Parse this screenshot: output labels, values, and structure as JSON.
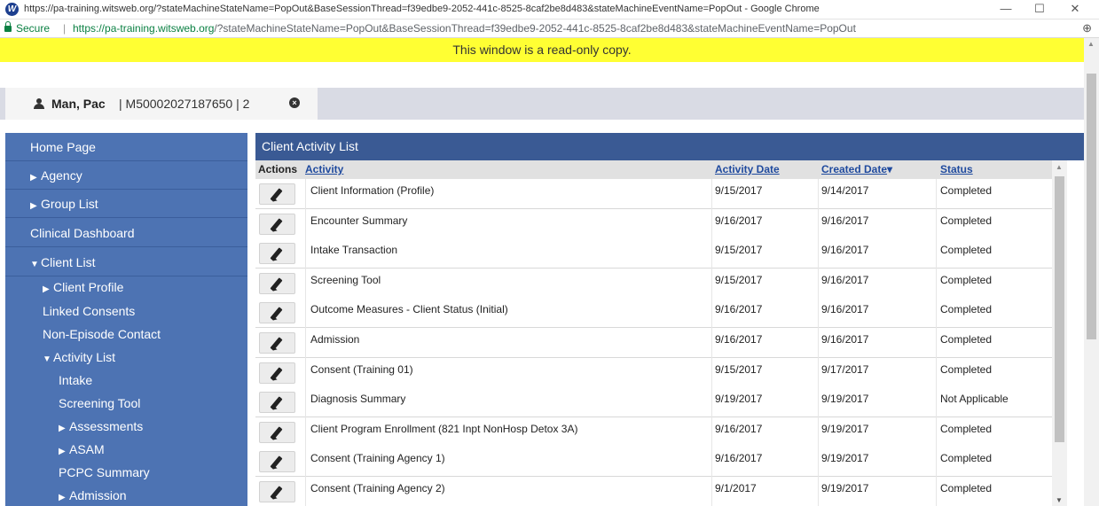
{
  "window": {
    "title": "https://pa-training.witsweb.org/?stateMachineStateName=PopOut&BaseSessionThread=f39edbe9-2052-441c-8525-8caf2be8d483&stateMachineEventName=PopOut - Google Chrome",
    "logo_letter": "W",
    "minimize": "—",
    "maximize": "☐",
    "close": "✕"
  },
  "address_bar": {
    "secure_label": "Secure",
    "separator": "|",
    "url_host": "https://pa-training.witsweb.org",
    "url_rest": "/?stateMachineStateName=PopOut&BaseSessionThread=f39edbe9-2052-441c-8525-8caf2be8d483&stateMachineEventName=PopOut",
    "zoom_icon": "⊕"
  },
  "banner": {
    "text": "This window is a read-only copy."
  },
  "client_tab": {
    "name": "Man, Pac",
    "id_text": "| M50002027187650 | 2",
    "close_glyph": "×"
  },
  "sidebar": {
    "home": "Home Page",
    "agency": "Agency",
    "group_list": "Group List",
    "clinical_dashboard": "Clinical Dashboard",
    "client_list": "Client List",
    "client_profile": "Client Profile",
    "linked_consents": "Linked Consents",
    "non_episode_contact": "Non-Episode Contact",
    "activity_list": "Activity List",
    "intake": "Intake",
    "screening_tool": "Screening Tool",
    "assessments": "Assessments",
    "asam": "ASAM",
    "pcpc_summary": "PCPC Summary",
    "admission": "Admission",
    "arrow_right": "▶",
    "arrow_down": "▼"
  },
  "main": {
    "title": "Client Activity List",
    "columns": {
      "actions": "Actions",
      "activity": "Activity",
      "activity_date": "Activity Date",
      "created_date": "Created Date",
      "sort_glyph": "▾",
      "status": "Status"
    },
    "rows": [
      {
        "activity": "Client Information (Profile)",
        "activity_date": "9/15/2017",
        "created_date": "9/14/2017",
        "status": "Completed"
      },
      {
        "activity": "Encounter Summary",
        "activity_date": "9/16/2017",
        "created_date": "9/16/2017",
        "status": "Completed"
      },
      {
        "activity": "Intake Transaction",
        "activity_date": "9/15/2017",
        "created_date": "9/16/2017",
        "status": "Completed"
      },
      {
        "activity": "Screening Tool",
        "activity_date": "9/15/2017",
        "created_date": "9/16/2017",
        "status": "Completed"
      },
      {
        "activity": "Outcome Measures - Client Status (Initial)",
        "activity_date": "9/16/2017",
        "created_date": "9/16/2017",
        "status": "Completed"
      },
      {
        "activity": "Admission",
        "activity_date": "9/16/2017",
        "created_date": "9/16/2017",
        "status": "Completed"
      },
      {
        "activity": "Consent (Training 01)",
        "activity_date": "9/15/2017",
        "created_date": "9/17/2017",
        "status": "Completed"
      },
      {
        "activity": "Diagnosis Summary",
        "activity_date": "9/19/2017",
        "created_date": "9/19/2017",
        "status": "Not Applicable"
      },
      {
        "activity": "Client Program Enrollment (821 Inpt NonHosp Detox 3A)",
        "activity_date": "9/16/2017",
        "created_date": "9/19/2017",
        "status": "Completed"
      },
      {
        "activity": "Consent (Training Agency 1)",
        "activity_date": "9/16/2017",
        "created_date": "9/19/2017",
        "status": "Completed"
      },
      {
        "activity": "Consent (Training Agency 2)",
        "activity_date": "9/1/2017",
        "created_date": "9/19/2017",
        "status": "Completed"
      }
    ]
  },
  "scroll": {
    "up": "▲",
    "down": "▼"
  }
}
